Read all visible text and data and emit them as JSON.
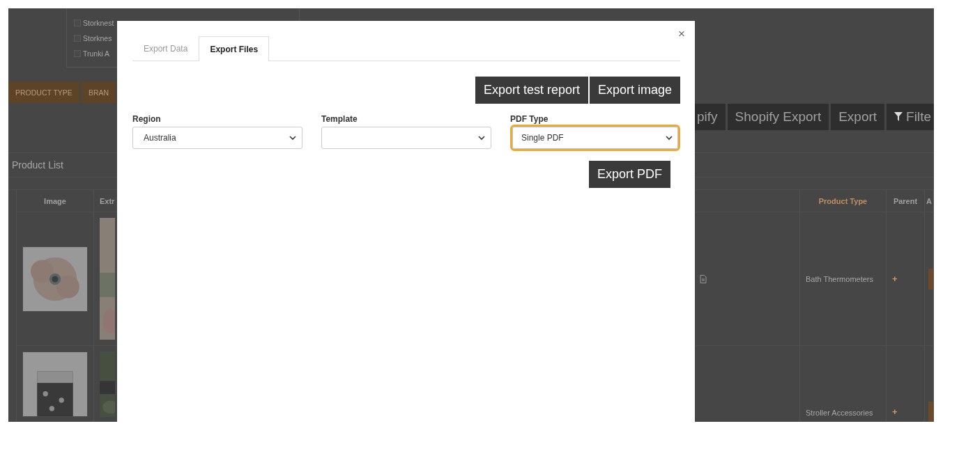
{
  "background": {
    "filter_options": [
      {
        "label": "Storknest",
        "checked": false
      },
      {
        "label": "Storknes",
        "checked": false
      },
      {
        "label": "Trunki A",
        "checked": false
      }
    ],
    "category_buttons": [
      "PRODUCT TYPE",
      "BRAN"
    ],
    "toolbar": [
      {
        "label": "pify",
        "kind": "text"
      },
      {
        "label": "Shopify Export",
        "kind": "text"
      },
      {
        "label": "Export",
        "kind": "text"
      },
      {
        "label": "Filte",
        "kind": "filter"
      }
    ],
    "section_title": "Product List",
    "table": {
      "columns": [
        "Image",
        "Extr",
        "Product Type",
        "Parent",
        "A"
      ],
      "rows": [
        {
          "product_type": "Bath Thermometers",
          "parent": "+"
        },
        {
          "product_type": "Stroller Accessories",
          "parent": "+"
        }
      ]
    }
  },
  "dialog": {
    "close": "×",
    "tabs": [
      {
        "label": "Export Data",
        "selected": false
      },
      {
        "label": "Export Files",
        "selected": true
      }
    ],
    "top_buttons": [
      "Export test report",
      "Export image"
    ],
    "fields": [
      {
        "label": "Region",
        "value": "Australia",
        "focused": false
      },
      {
        "label": "Template",
        "focused": false
      },
      {
        "label": "PDF Type",
        "value": "Single PDF",
        "focused": true
      }
    ],
    "bottom_button": "Export PDF"
  }
}
